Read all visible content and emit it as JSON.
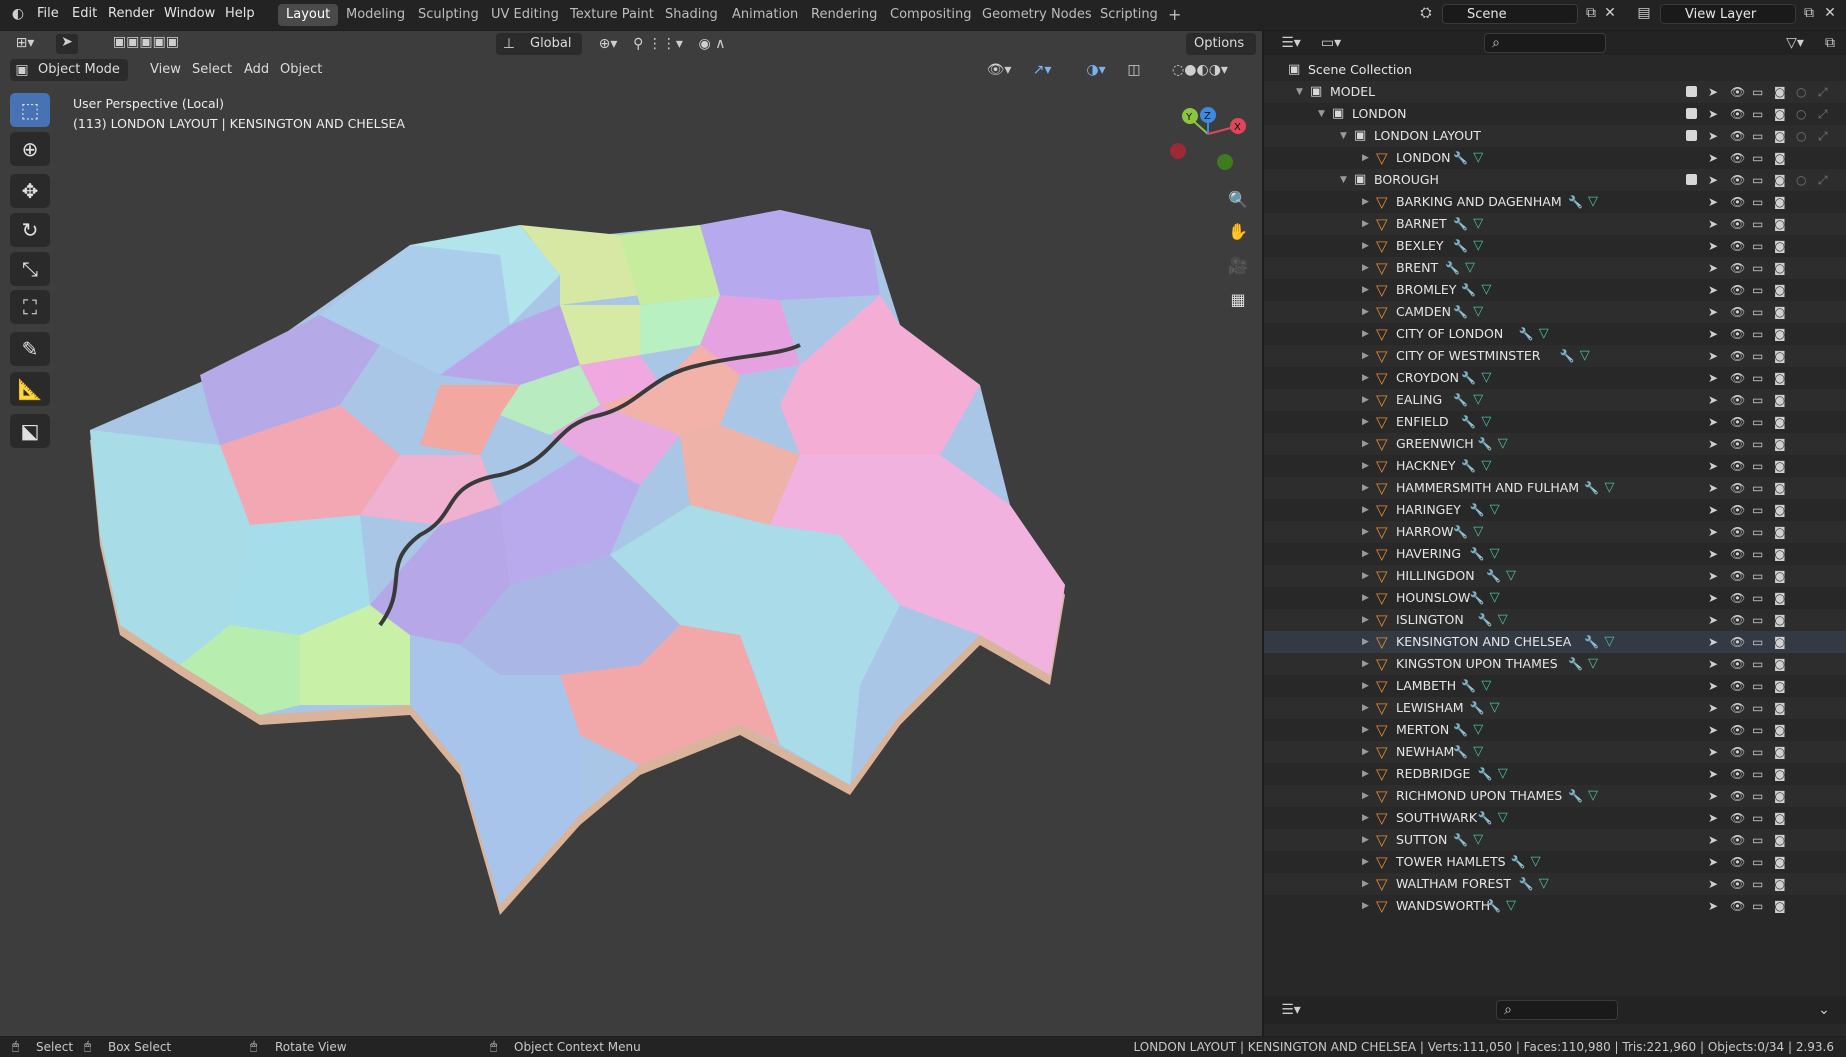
{
  "menu": {
    "file": "File",
    "edit": "Edit",
    "render": "Render",
    "window": "Window",
    "help": "Help"
  },
  "workspaces": [
    "Layout",
    "Modeling",
    "Sculpting",
    "UV Editing",
    "Texture Paint",
    "Shading",
    "Animation",
    "Rendering",
    "Compositing",
    "Geometry Nodes",
    "Scripting"
  ],
  "add_workspace": "+",
  "scene": {
    "label": "Scene"
  },
  "view_layer": {
    "label": "View Layer"
  },
  "viewport": {
    "mode": "Object Mode",
    "menus": [
      "View",
      "Select",
      "Add",
      "Object"
    ],
    "orientation": "Global",
    "options": "Options",
    "overlay_title": "User Perspective (Local)",
    "overlay_subtitle": "(113) LONDON LAYOUT | KENSINGTON AND CHELSEA",
    "gizmo": {
      "y": "Y",
      "z": "Z",
      "x": "X"
    }
  },
  "outliner": {
    "root": "Scene Collection",
    "model": "MODEL",
    "london_coll": "LONDON",
    "london_layout": "LONDON LAYOUT",
    "london_obj": "LONDON",
    "borough": "BOROUGH",
    "boroughs": [
      "BARKING AND DAGENHAM",
      "BARNET",
      "BEXLEY",
      "BRENT",
      "BROMLEY",
      "CAMDEN",
      "CITY OF LONDON",
      "CITY OF WESTMINSTER",
      "CROYDON",
      "EALING",
      "ENFIELD",
      "GREENWICH",
      "HACKNEY",
      "HAMMERSMITH AND FULHAM",
      "HARINGEY",
      "HARROW",
      "HAVERING",
      "HILLINGDON",
      "HOUNSLOW",
      "ISLINGTON",
      "KENSINGTON AND CHELSEA",
      "KINGSTON UPON THAMES",
      "LAMBETH",
      "LEWISHAM",
      "MERTON",
      "NEWHAM",
      "REDBRIDGE",
      "RICHMOND UPON THAMES",
      "SOUTHWARK",
      "SUTTON",
      "TOWER HAMLETS",
      "WALTHAM FOREST",
      "WANDSWORTH"
    ],
    "selected": "KENSINGTON AND CHELSEA"
  },
  "status": {
    "select": "Select",
    "box_select": "Box Select",
    "rotate": "Rotate View",
    "context": "Object Context Menu",
    "stats": "LONDON LAYOUT | KENSINGTON AND CHELSEA | Verts:111,050 | Faces:110,980 | Tris:221,960 | Objects:0/34 | 2.93.6"
  },
  "colors": {
    "accent": "#4772b3",
    "mesh_icon": "#e58a31",
    "viewport_bg": "#3d3d3d"
  }
}
